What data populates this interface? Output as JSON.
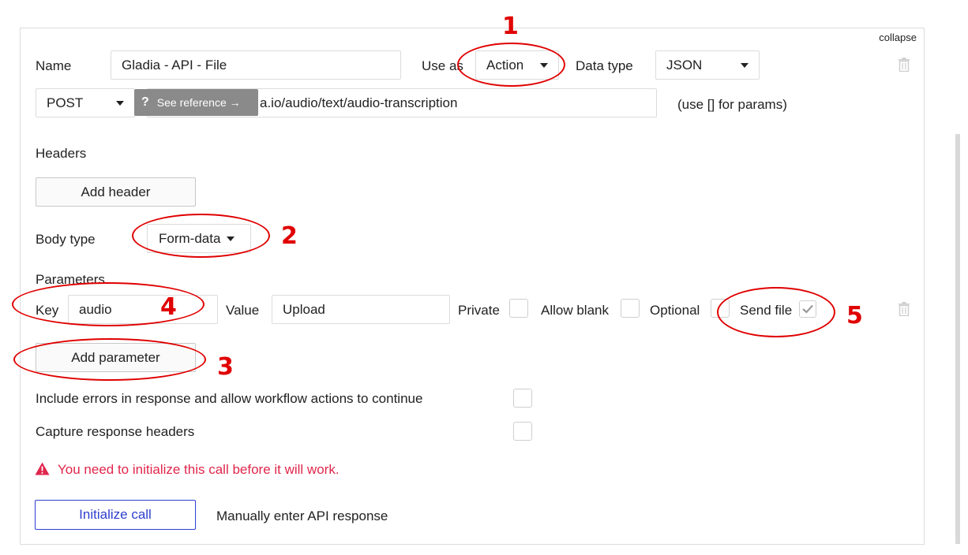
{
  "collapse_label": "collapse",
  "call": {
    "name_label": "Name",
    "name_value": "Gladia - API - File",
    "use_as_label": "Use as",
    "use_as_value": "Action",
    "data_type_label": "Data type",
    "data_type_value": "JSON",
    "method_value": "POST",
    "url_value": "a.io/audio/text/audio-transcription",
    "params_hint": "(use [] for params)",
    "tooltip_icon": "?",
    "tooltip_text": "See reference →"
  },
  "headers": {
    "title": "Headers",
    "add_button": "Add header"
  },
  "body": {
    "label": "Body type",
    "value": "Form-data"
  },
  "parameters": {
    "title": "Parameters",
    "key_label": "Key",
    "key_value": "audio",
    "value_label": "Value",
    "value_value": "Upload",
    "private_label": "Private",
    "allow_blank_label": "Allow blank",
    "optional_label": "Optional",
    "send_file_label": "Send file",
    "add_button": "Add parameter"
  },
  "options": {
    "include_errors": "Include errors in response and allow workflow actions to continue",
    "capture_headers": "Capture response headers"
  },
  "warning": {
    "icon": "warning-triangle-icon",
    "text": "You need to initialize this call before it will work."
  },
  "actions": {
    "initialize": "Initialize call",
    "manual": "Manually enter API response"
  },
  "annotations": [
    "1",
    "2",
    "3",
    "4",
    "5"
  ],
  "colors": {
    "annotation": "#e00000",
    "warning": "#e0264b",
    "primary": "#2e3fcf"
  }
}
